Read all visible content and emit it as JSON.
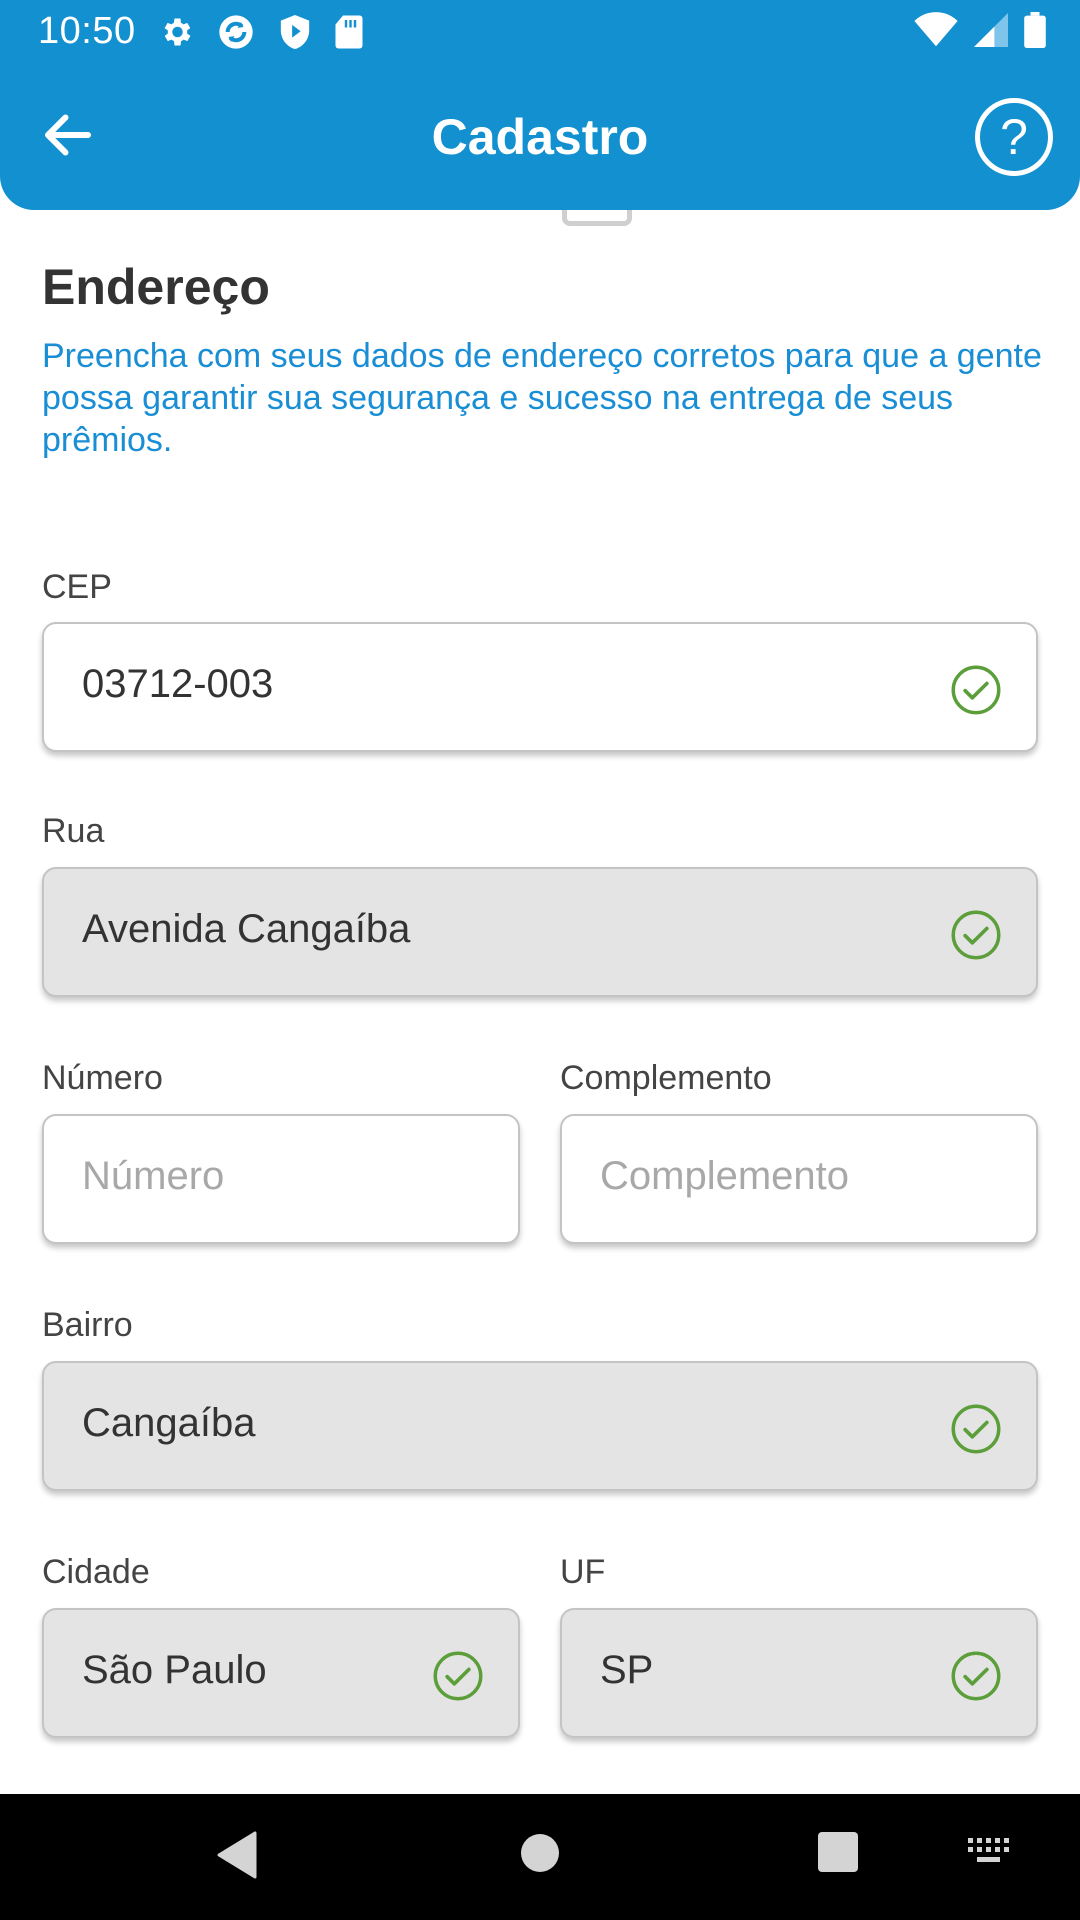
{
  "status_bar": {
    "time": "10:50",
    "icons_left": [
      "gear-icon",
      "sync-icon",
      "shield-icon",
      "sd-card-icon"
    ],
    "icons_right": [
      "wifi-icon",
      "signal-icon",
      "battery-icon"
    ]
  },
  "appbar": {
    "title": "Cadastro",
    "back_icon": "arrow-left-icon",
    "help_label": "?",
    "color": "#1290d0"
  },
  "section": {
    "title": "Endereço",
    "description": "Preencha com seus dados de endereço corretos para que a gente possa garantir sua segurança e sucesso na entrega de seus prêmios."
  },
  "fields": {
    "cep": {
      "label": "CEP",
      "value": "03712-003",
      "valid": true
    },
    "rua": {
      "label": "Rua",
      "value": "Avenida Cangaíba",
      "valid": true,
      "readonly": true
    },
    "numero": {
      "label": "Número",
      "value": "",
      "placeholder": "Número"
    },
    "complemento": {
      "label": "Complemento",
      "value": "",
      "placeholder": "Complemento"
    },
    "bairro": {
      "label": "Bairro",
      "value": "Cangaíba",
      "valid": true,
      "readonly": true
    },
    "cidade": {
      "label": "Cidade",
      "value": "São Paulo",
      "valid": true,
      "readonly": true
    },
    "uf": {
      "label": "UF",
      "value": "SP",
      "valid": true,
      "readonly": true
    }
  },
  "colors": {
    "accent": "#1290d0",
    "description": "#1a8ed4",
    "valid_check": "#5b9e3a",
    "readonly_bg": "#e4e4e4"
  },
  "navbar": {
    "buttons": [
      "back-triangle-icon",
      "home-circle-icon",
      "recents-square-icon",
      "keyboard-icon"
    ]
  }
}
